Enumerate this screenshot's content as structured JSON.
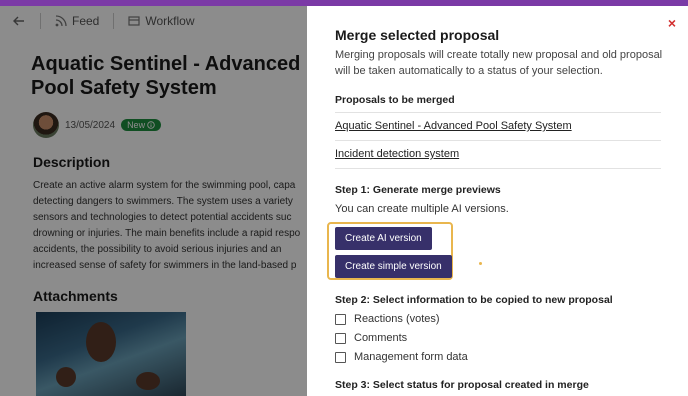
{
  "nav": {
    "feed": "Feed",
    "workflow": "Workflow"
  },
  "proposal": {
    "title": "Aquatic Sentinel - Advanced Pool Safety System",
    "date": "13/05/2024",
    "badge": "New",
    "description_heading": "Description",
    "description": "Create an active alarm system for the swimming pool, capa detecting dangers to swimmers. The system uses a variety sensors and technologies to detect potential accidents suc drowning or injuries. The main benefits include a rapid respo accidents, the possibility to avoid serious injuries and an increased sense of safety for swimmers in the land-based p",
    "attachments_heading": "Attachments"
  },
  "modal": {
    "close": "×",
    "title": "Merge selected proposal",
    "intro": "Merging proposals will create totally new proposal and old proposal will be taken automatically to a status of your selection.",
    "proposals_heading": "Proposals to be merged",
    "proposals": [
      "Aquatic Sentinel - Advanced Pool Safety System",
      "Incident detection system"
    ],
    "step1_heading": "Step 1: Generate merge previews",
    "step1_text": "You can create multiple AI versions.",
    "btn_ai": "Create AI version",
    "btn_simple": "Create simple version",
    "step2_heading": "Step 2: Select information to be copied to new proposal",
    "options": [
      "Reactions (votes)",
      "Comments",
      "Management form data"
    ],
    "step3_heading": "Step 3: Select status for proposal created in merge"
  },
  "colors": {
    "accent_bar": "#7b3aa6",
    "button": "#37306a",
    "highlight": "#e9b64e",
    "badge": "#1e8e3e",
    "close": "#d32f2f"
  }
}
